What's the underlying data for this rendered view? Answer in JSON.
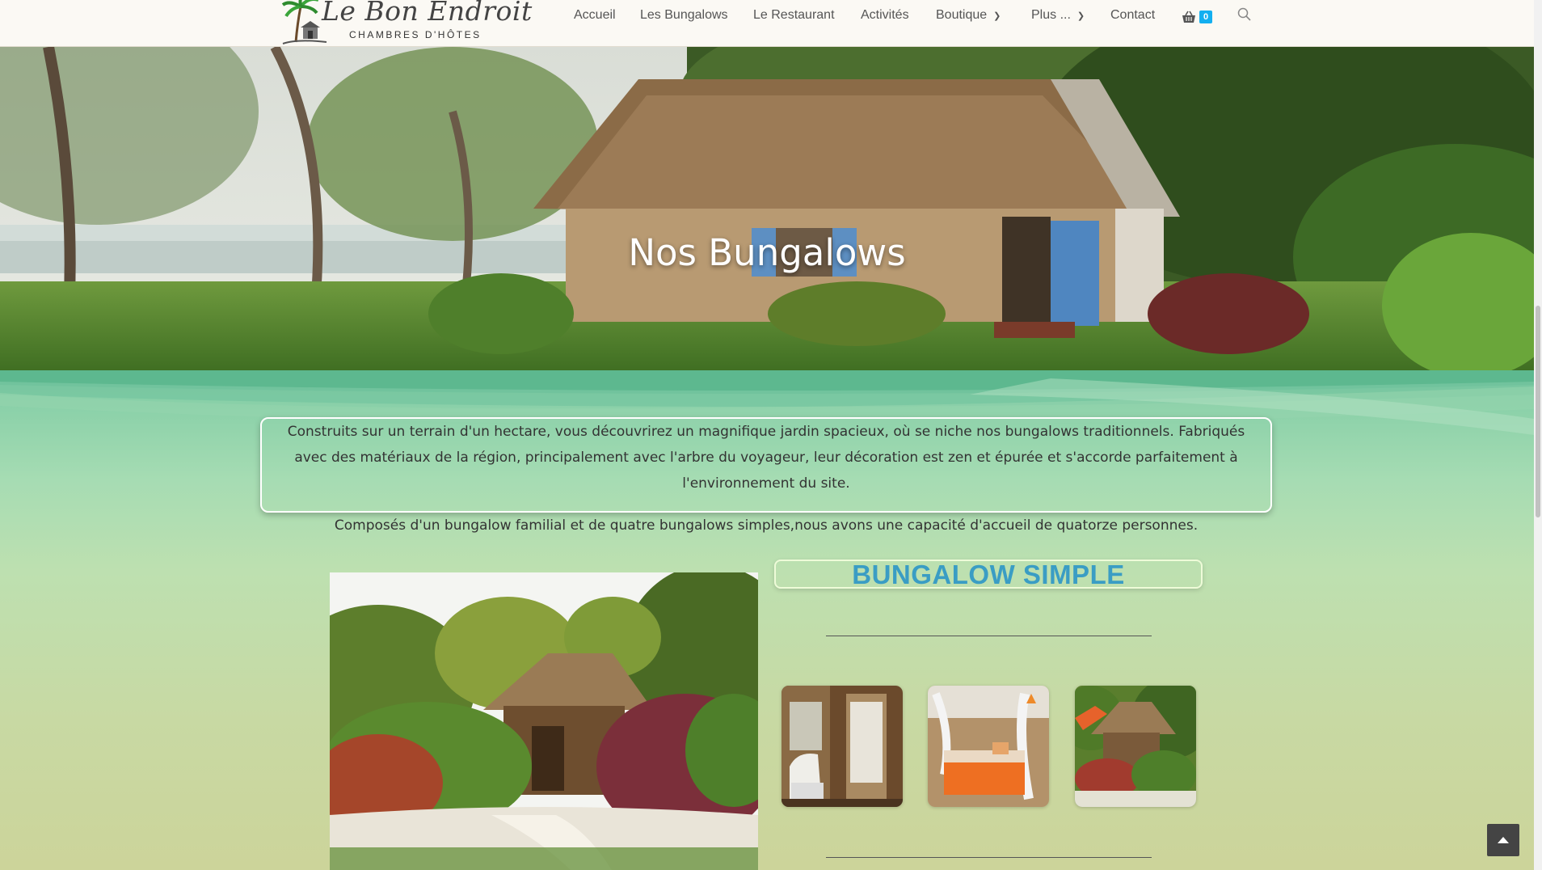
{
  "header": {
    "logo_title": "Le Bon Endroit",
    "logo_subtitle": "CHAMBRES D'HÔTES",
    "nav": [
      {
        "label": "Accueil"
      },
      {
        "label": "Les Bungalows"
      },
      {
        "label": "Le Restaurant"
      },
      {
        "label": "Activités"
      },
      {
        "label": "Boutique"
      },
      {
        "label": "Plus ..."
      },
      {
        "label": "Contact"
      }
    ],
    "cart_count": "0"
  },
  "hero": {
    "title": "Nos Bungalows"
  },
  "intro": {
    "paragraph1": "Construits sur un terrain d'un hectare, vous découvrirez un magnifique jardin spacieux, où se niche nos bungalows traditionnels. Fabriqués avec des matériaux de la région, principalement avec l'arbre du voyageur, leur décoration est zen et épurée et s'accorde parfaitement à l'environnement du site.",
    "paragraph2": "Composés d'un bungalow familial et de quatre bungalows simples,nous avons une capacité d'accueil de quatorze personnes."
  },
  "section": {
    "title": "BUNGALOW SIMPLE"
  },
  "icons": {
    "cart": "basket-icon",
    "search": "search-icon",
    "dropdown": "chevron-down-icon",
    "back_to_top": "chevron-up-icon"
  },
  "colors": {
    "accent": "#13aff0",
    "section_title": "#3a9dc4",
    "header_bg": "#fbf9f4"
  }
}
